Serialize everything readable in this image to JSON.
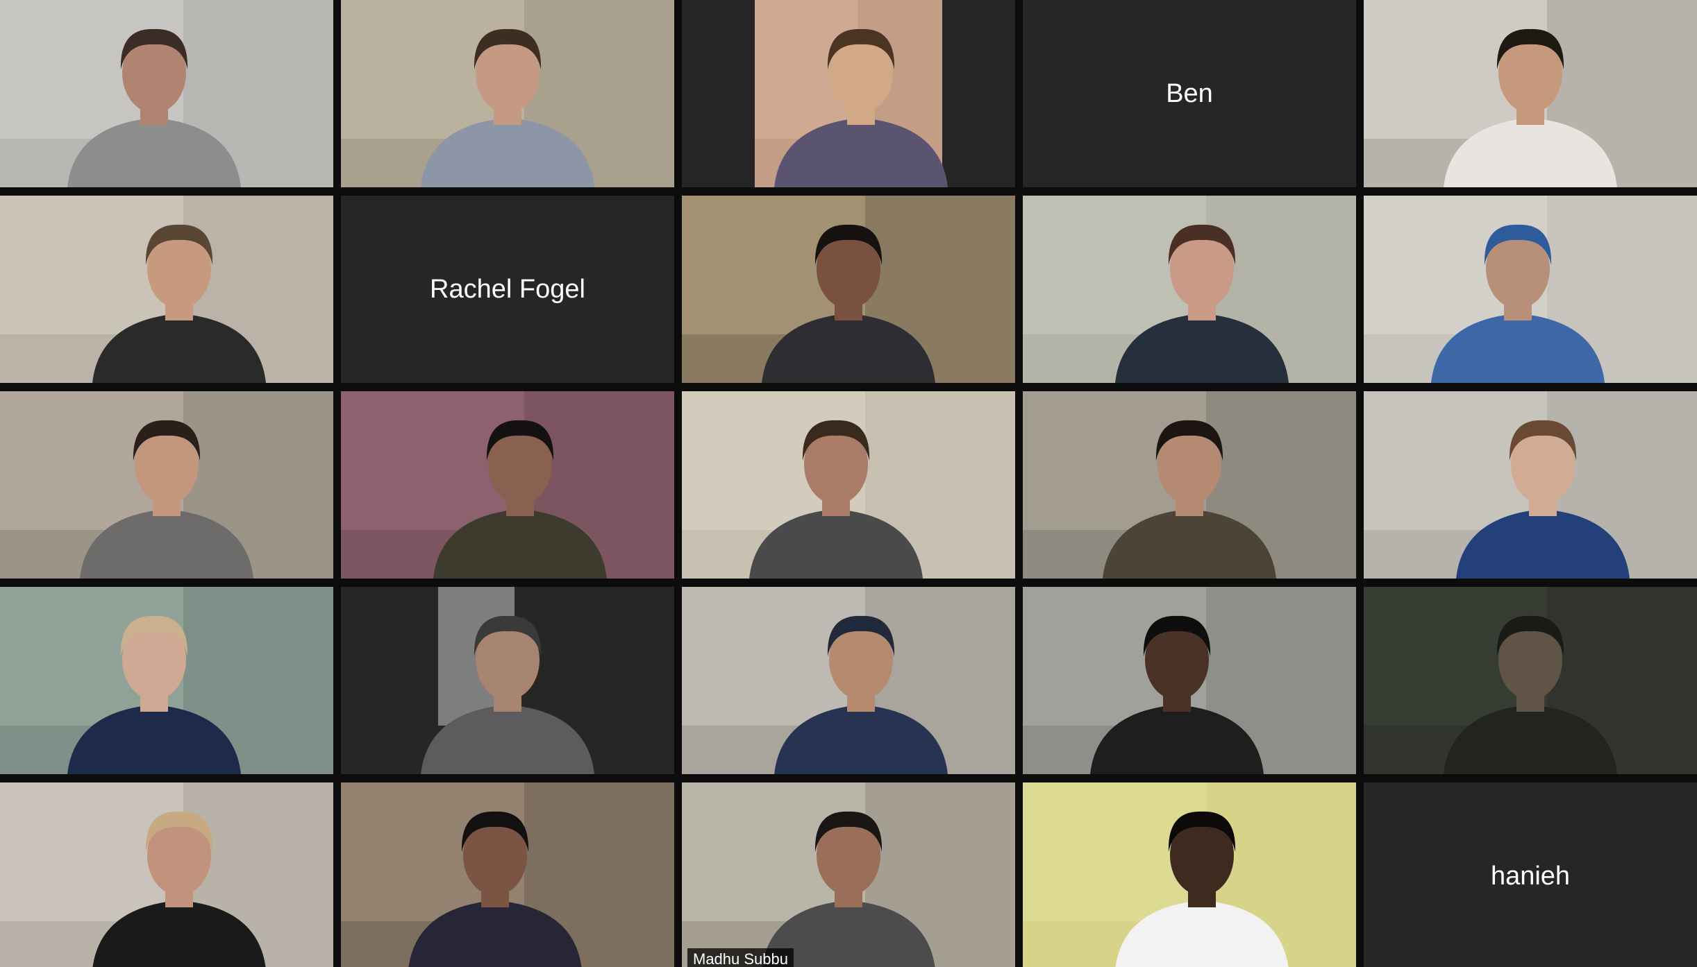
{
  "meeting": {
    "layout": "gallery",
    "columns": 5,
    "rows": 5
  },
  "participants": [
    {
      "display": "video",
      "bg": "#b9b7b3",
      "wall": "#d4d2ce",
      "skin": "#b08470",
      "shirt": "#8d8d8d",
      "hair": "#3b2c25"
    },
    {
      "display": "video",
      "bg": "#a9a08e",
      "wall": "#c9c1ad",
      "skin": "#c49a83",
      "shirt": "#8c96a6",
      "hair": "#3e2d22"
    },
    {
      "display": "video",
      "bg": "#c39d86",
      "wall": "#d8b29b",
      "skin": "#d3a887",
      "shirt": "#5a5470",
      "hair": "#4a3424",
      "letterbox": true
    },
    {
      "display": "name",
      "name": "Ben"
    },
    {
      "display": "video",
      "bg": "#b8b3aa",
      "wall": "#e2dfd8",
      "skin": "#c6987c",
      "shirt": "#e8e5e0",
      "hair": "#1f1914"
    },
    {
      "display": "video",
      "bg": "#bbb3a8",
      "wall": "#d6cfc4",
      "skin": "#c79a80",
      "shirt": "#2a2a2a",
      "hair": "#5a4634"
    },
    {
      "display": "name",
      "name": "Rachel Fogel"
    },
    {
      "display": "video",
      "bg": "#8a7a62",
      "wall": "#b8a482",
      "skin": "#7a5140",
      "shirt": "#2e2e32",
      "hair": "#16120f"
    },
    {
      "display": "video",
      "bg": "#b4b3a8",
      "wall": "#c9c8bd",
      "skin": "#c99a86",
      "shirt": "#26303d",
      "hair": "#4a3024"
    },
    {
      "display": "video",
      "bg": "#c7c4bd",
      "wall": "#dddbd6",
      "skin": "#b8907a",
      "shirt": "#3e67a8",
      "hair": "#2e5b9a"
    },
    {
      "display": "video",
      "bg": "#9d9488",
      "wall": "#bfb7aa",
      "skin": "#c2977e",
      "shirt": "#6e6c6a",
      "hair": "#2a1f1a"
    },
    {
      "display": "video",
      "bg": "#7d5560",
      "wall": "#9a6c78",
      "skin": "#8a6150",
      "shirt": "#3d3a2e",
      "hair": "#151111"
    },
    {
      "display": "video",
      "bg": "#c8c1b2",
      "wall": "#ddd6c7",
      "skin": "#a87c66",
      "shirt": "#4a4a4c",
      "hair": "#3a2a1e"
    },
    {
      "display": "video",
      "bg": "#8e8a7f",
      "wall": "#b3ad9f",
      "skin": "#b48a72",
      "shirt": "#4d4438",
      "hair": "#1c1511"
    },
    {
      "display": "video",
      "bg": "#b6b3ac",
      "wall": "#d5d2cb",
      "skin": "#d2ab94",
      "shirt": "#24407a",
      "hair": "#6a4a34"
    },
    {
      "display": "video",
      "bg": "#7e9088",
      "wall": "#9fb1a6",
      "skin": "#d0a995",
      "shirt": "#1e2a4a",
      "hair": "#c9b08e"
    },
    {
      "display": "video",
      "bg": "#262626",
      "wall": "#c7c7c7",
      "skin": "#a7846f",
      "shirt": "#5c5c5e",
      "hair": "#3a3a3a",
      "letterbox": true
    },
    {
      "display": "video",
      "bg": "#a9a49c",
      "wall": "#cfcbc4",
      "skin": "#b68a6e",
      "shirt": "#263352",
      "hair": "#202a3c"
    },
    {
      "display": "video",
      "bg": "#8f8f89",
      "wall": "#b1b1aa",
      "skin": "#4a3226",
      "shirt": "#1e1e1e",
      "hair": "#0e0e0e"
    },
    {
      "display": "video",
      "bg": "#30342c",
      "wall": "#3e4339",
      "skin": "#5f5446",
      "shirt": "#22251f",
      "hair": "#1a1a16"
    },
    {
      "display": "video",
      "bg": "#b9b2a8",
      "wall": "#d7d2ca",
      "skin": "#c1937c",
      "shirt": "#1a1a1a",
      "hair": "#c8aa82"
    },
    {
      "display": "video",
      "bg": "#7d6e5e",
      "wall": "#a69380",
      "skin": "#7c5443",
      "shirt": "#262636",
      "hair": "#121010"
    },
    {
      "display": "video",
      "bg": "#a59f93",
      "wall": "#cbc6bc",
      "skin": "#9a6e58",
      "shirt": "#4c4c4c",
      "hair": "#1a1614",
      "active": true,
      "label": "Madhu Subbu"
    },
    {
      "display": "video",
      "bg": "#d7d48a",
      "wall": "#e2df9c",
      "skin": "#3f2a20",
      "shirt": "#f2f2f2",
      "hair": "#0d0b0a"
    },
    {
      "display": "name",
      "name": "hanieh"
    }
  ]
}
